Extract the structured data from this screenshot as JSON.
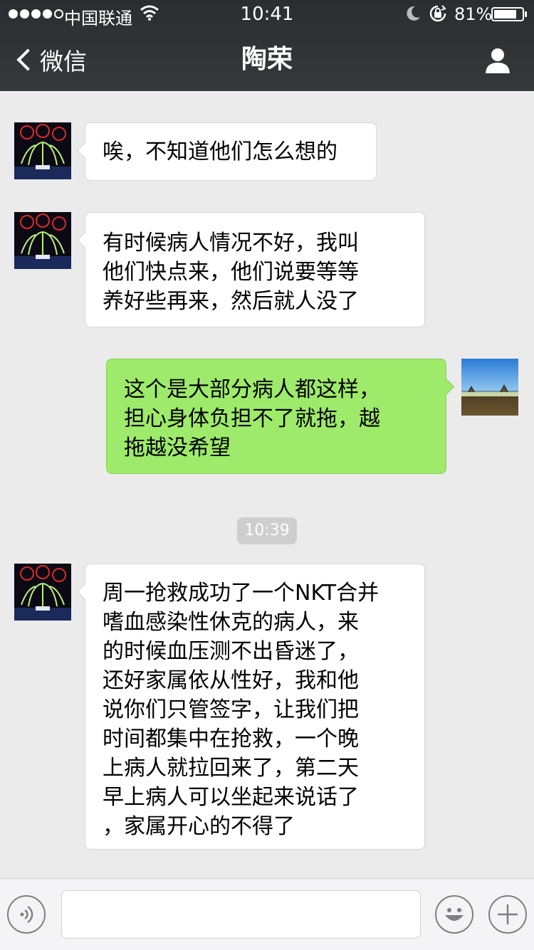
{
  "status_bar": {
    "carrier": "中国联通",
    "time": "10:41",
    "battery": "81%",
    "battery_level": 0.81
  },
  "nav": {
    "back_label": "微信",
    "title": "陶荣"
  },
  "messages": [
    {
      "side": "left",
      "lines": [
        "唉，不知道他们怎么想的"
      ]
    },
    {
      "side": "left",
      "lines": [
        "有时候病人情况不好，我叫",
        "他们快点来，他们说要等等",
        "养好些再来，然后就人没了"
      ]
    },
    {
      "side": "right",
      "lines": [
        "这个是大部分病人都这样，",
        "担心身体负担不了就拖，越",
        "拖越没希望"
      ]
    },
    {
      "timestamp": "10:39"
    },
    {
      "side": "left",
      "lines": [
        "周一抢救成功了一个NKT合并",
        "嗜血感染性休克的病人，来",
        "的时候血压测不出昏迷了，",
        "还好家属依从性好，我和他",
        "说你们只管签字，让我们把",
        "时间都集中在抢救，一个晚",
        "上病人就拉回来了，第二天",
        "早上病人可以坐起来说话了",
        "，家属开心的不得了"
      ]
    }
  ],
  "icons": {
    "signal": "signal-dots-icon",
    "wifi": "wifi-icon",
    "moon": "moon-icon",
    "rotation_lock": "rotation-lock-icon",
    "battery": "battery-icon",
    "back": "chevron-left-icon",
    "profile": "person-icon",
    "voice": "voice-icon",
    "emoji": "emoji-icon",
    "plus": "plus-icon"
  },
  "colors": {
    "nav_bg": "#2e3133",
    "chat_bg": "#ebebeb",
    "bubble_left": "#ffffff",
    "bubble_right": "#9eea6a",
    "timestamp_bg": "#cecece"
  }
}
